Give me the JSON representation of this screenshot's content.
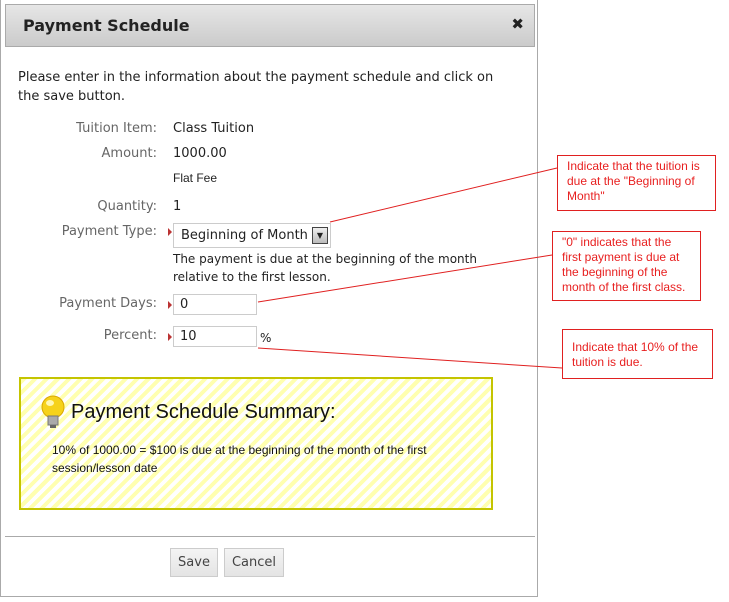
{
  "dialog": {
    "title": "Payment Schedule",
    "close_icon": "close-icon",
    "intro": "Please enter in the information about the payment schedule and click on the save button."
  },
  "form": {
    "tuition_item": {
      "label": "Tuition Item:",
      "value": "Class Tuition"
    },
    "amount": {
      "label": "Amount:",
      "value": "1000.00",
      "note": "Flat Fee"
    },
    "quantity": {
      "label": "Quantity:",
      "value": "1"
    },
    "payment_type": {
      "label": "Payment Type:",
      "value": "Beginning of Month",
      "help": "The payment is due at the beginning of the month relative to the first lesson."
    },
    "payment_days": {
      "label": "Payment Days:",
      "value": "0"
    },
    "percent": {
      "label": "Percent:",
      "value": "10",
      "unit": "%"
    }
  },
  "summary": {
    "title": "Payment Schedule Summary:",
    "text": "10% of 1000.00 = $100 is due at the beginning of the month of the first session/lesson date",
    "icon": "lightbulb-icon"
  },
  "buttons": {
    "save": "Save",
    "cancel": "Cancel"
  },
  "callouts": [
    "Indicate that the tuition is due at the \"Beginning of Month\"",
    "\"0\" indicates that the first payment is due at the beginning of the month of the first class.",
    "Indicate that 10% of the tuition is due."
  ],
  "colors": {
    "callout": "#e02020",
    "summary_border": "#c4c400",
    "summary_stripe": "#ffffb0"
  }
}
